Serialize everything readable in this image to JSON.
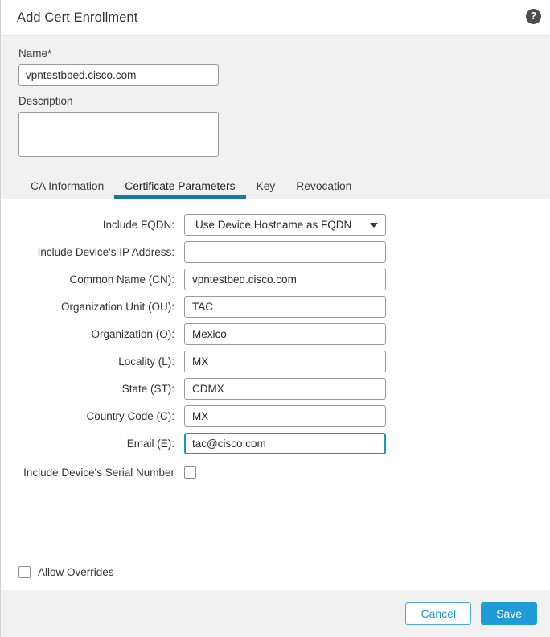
{
  "dialog": {
    "title": "Add Cert Enrollment",
    "help_icon": "help-circle-icon",
    "help_glyph": "?"
  },
  "name_field": {
    "label": "Name*",
    "value": "vpntestbbed.cisco.com",
    "placeholder": ""
  },
  "description_field": {
    "label": "Description",
    "value": "",
    "placeholder": ""
  },
  "tabs": [
    {
      "label": "CA Information",
      "active": false
    },
    {
      "label": "Certificate Parameters",
      "active": true
    },
    {
      "label": "Key",
      "active": false
    },
    {
      "label": "Revocation",
      "active": false
    }
  ],
  "certificate_parameters": {
    "include_fqdn": {
      "label": "Include FQDN:",
      "value": "Use Device Hostname as FQDN",
      "caret_icon": "chevron-down-icon"
    },
    "include_device_ip": {
      "label": "Include Device's IP Address:",
      "value": "",
      "placeholder": ""
    },
    "common_name": {
      "label": "Common Name (CN):",
      "value": "vpntestbed.cisco.com",
      "placeholder": ""
    },
    "organization_unit": {
      "label": "Organization Unit (OU):",
      "value": "TAC",
      "placeholder": ""
    },
    "organization": {
      "label": "Organization (O):",
      "value": "Mexico",
      "placeholder": ""
    },
    "locality": {
      "label": "Locality (L):",
      "value": "MX",
      "placeholder": ""
    },
    "state": {
      "label": "State (ST):",
      "value": "CDMX",
      "placeholder": ""
    },
    "country_code": {
      "label": "Country Code (C):",
      "value": "MX",
      "placeholder": ""
    },
    "email": {
      "label": "Email (E):",
      "value": "tac@cisco.com",
      "placeholder": "",
      "focused": true
    },
    "include_serial_number": {
      "label": "Include Device's Serial Number",
      "checked": false
    }
  },
  "allow_overrides": {
    "label": "Allow Overrides",
    "checked": false
  },
  "footer": {
    "cancel_label": "Cancel",
    "save_label": "Save"
  },
  "colors": {
    "accent_blue": "#1f9bd7",
    "tab_underline": "#1878a5",
    "focus_border": "#1898c8",
    "panel_gray": "#f1f1f1",
    "text_dark": "#333333"
  }
}
